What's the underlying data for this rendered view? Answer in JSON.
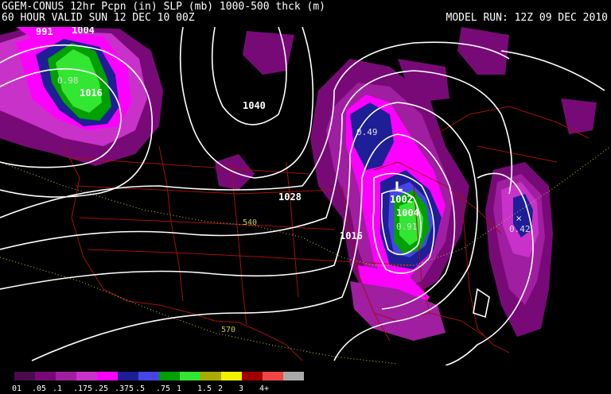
{
  "header": {
    "line1": "GGEM-CONUS 12hr Pcpn (in) SLP (mb) 1000-500 thck (m)",
    "line2": "60 HOUR VALID SUN 12 DEC 10 00Z",
    "model_run": "MODEL RUN: 12Z 09 DEC 2010"
  },
  "colors": {
    "isobar": "#ffffff",
    "thickness": "#c8c84a",
    "borders": "#a01010",
    "background": "#000000"
  },
  "pressure_labels": [
    {
      "text": "991"
    },
    {
      "text": "1004"
    },
    {
      "text": "1016"
    },
    {
      "text": "1040"
    },
    {
      "text": "1028"
    },
    {
      "text": "1016"
    },
    {
      "text": "1002"
    },
    {
      "text": "1004"
    }
  ],
  "low_marker": "L",
  "thickness_labels": [
    {
      "text": "540"
    },
    {
      "text": "570"
    }
  ],
  "precip_max_labels": [
    {
      "text": "0.98"
    },
    {
      "text": "0.49"
    },
    {
      "text": "0.91"
    },
    {
      "text": "0.42"
    }
  ],
  "legend": {
    "bins": [
      {
        "label": "01",
        "color": "#4b0a4b"
      },
      {
        "label": ".05",
        "color": "#780a78"
      },
      {
        "label": ".1",
        "color": "#a01ea0"
      },
      {
        "label": ".175",
        "color": "#c832c8"
      },
      {
        "label": ".25",
        "color": "#ff00ff"
      },
      {
        "label": ".375",
        "color": "#1e1e96"
      },
      {
        "label": ".5",
        "color": "#4646e6"
      },
      {
        "label": ".75",
        "color": "#00a000"
      },
      {
        "label": "1",
        "color": "#32e632"
      },
      {
        "label": "1.5",
        "color": "#aaaa00"
      },
      {
        "label": "2",
        "color": "#f0f000"
      },
      {
        "label": "3",
        "color": "#a00000"
      },
      {
        "label": "4+",
        "color": "#f04646"
      },
      {
        "label": "",
        "color": "#aaaaaa"
      }
    ]
  }
}
